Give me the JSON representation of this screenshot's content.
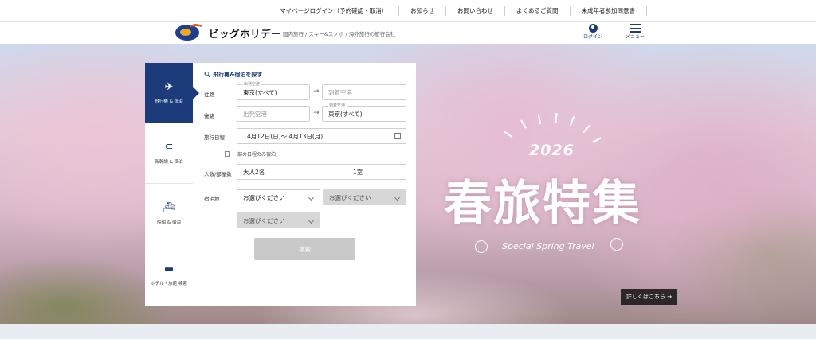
{
  "top_nav": {
    "items": [
      "マイページログイン（予約確認・取消）",
      "お知らせ",
      "お問い合わせ",
      "よくあるご質問",
      "未成年者参加同意書"
    ]
  },
  "header": {
    "logo_text": "ビッグホリデー",
    "tagline": "国内旅行 / スキー&スノボ / 海外旅行の旅行会社",
    "login_label": "ログイン",
    "menu_label": "メニュー",
    "brand_color": "#1b3b7a"
  },
  "search": {
    "tabs": [
      {
        "label": "飛行機 & 宿泊",
        "icon": "airplane-icon",
        "active": true
      },
      {
        "label": "新幹線 & 宿泊",
        "icon": "shinkansen-icon",
        "active": false
      },
      {
        "label": "船舶 & 宿泊",
        "icon": "ship-icon",
        "active": false
      },
      {
        "label": "ホテル・旅館 検索",
        "icon": "bed-icon",
        "active": false
      }
    ],
    "title": "飛行機&宿泊を探す",
    "outbound": {
      "label": "往路",
      "from_mini": "出発空港",
      "from_value": "東京(すべて)",
      "to_placeholder": "到着空港"
    },
    "return": {
      "label": "復路",
      "from_placeholder": "出発空港",
      "to_mini": "到着空港",
      "to_value": "東京(すべて)"
    },
    "dates": {
      "label": "旅行日程",
      "value": "4月12日(日)〜 4月13日(月)",
      "partial_stay": "一部の日程のみ宿泊"
    },
    "people": {
      "label": "人数/部屋数",
      "value": "大人2名",
      "rooms": "1室"
    },
    "lodging": {
      "label": "宿泊地",
      "select1": "お選びください",
      "select2": "お選びください",
      "select3": "お選びください"
    },
    "search_button": "検索"
  },
  "campaign": {
    "year": "2026",
    "title": "春旅特集",
    "subtitle": "Special Spring Travel",
    "details_button": "詳しくはこちら →"
  }
}
